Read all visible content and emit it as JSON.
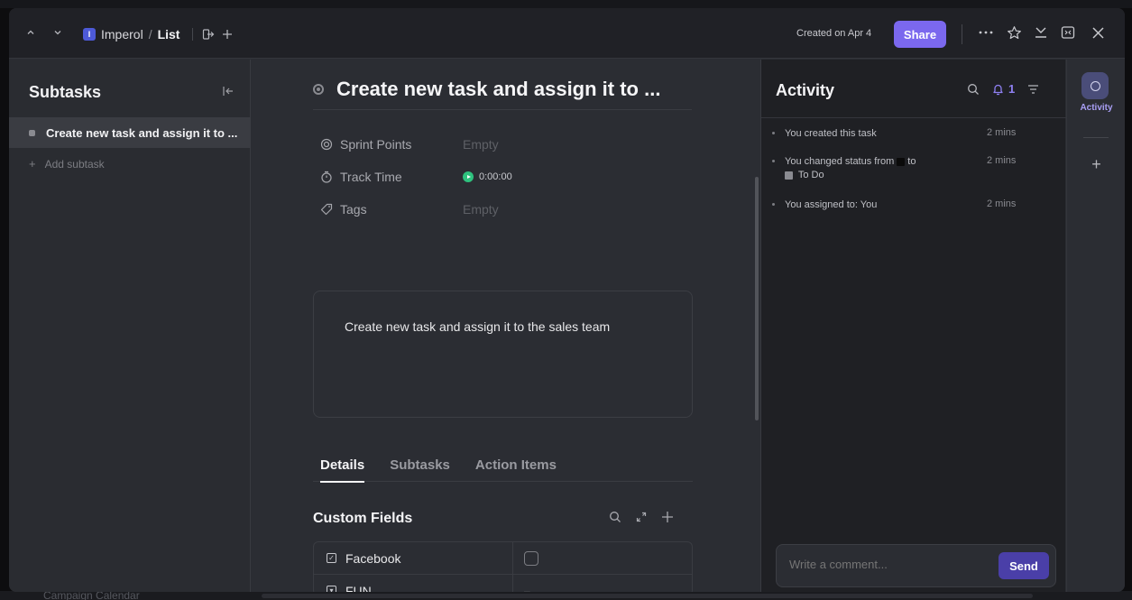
{
  "breadcrumb": {
    "space_initial": "I",
    "space_name": "Imperol",
    "separator": "/",
    "list_name": "List"
  },
  "header": {
    "created": "Created on Apr 4",
    "share_label": "Share"
  },
  "subtasks": {
    "title": "Subtasks",
    "items": [
      {
        "label": "Create new task and assign it to ..."
      }
    ],
    "add_label": "Add subtask"
  },
  "task": {
    "title": "Create new task and assign it to ...",
    "fields": [
      {
        "label": "Sprint Points",
        "value": "Empty"
      },
      {
        "label": "Track Time",
        "value": "0:00:00"
      },
      {
        "label": "Tags",
        "value": "Empty"
      }
    ],
    "description": "Create new task and assign it to the sales team"
  },
  "tabs": [
    {
      "label": "Details"
    },
    {
      "label": "Subtasks"
    },
    {
      "label": "Action Items"
    }
  ],
  "custom_fields": {
    "title": "Custom Fields",
    "rows": [
      {
        "name": "Facebook",
        "value": ""
      },
      {
        "name": "FUN",
        "value": "–"
      }
    ]
  },
  "activity": {
    "title": "Activity",
    "notification_count": "1",
    "items": [
      {
        "actor": "You",
        "text": "created this task",
        "time": "2 mins"
      },
      {
        "actor": "You",
        "text": "changed status from",
        "mid": "to",
        "status": "To Do",
        "time": "2 mins"
      },
      {
        "actor": "You",
        "text": "assigned to: You",
        "time": "2 mins"
      }
    ],
    "comment_placeholder": "Write a comment...",
    "send_label": "Send"
  },
  "rail": {
    "active_label": "Activity"
  },
  "backdrop": {
    "list_label": "Campaign Calendar"
  },
  "colors": {
    "accent": "#7b68ee",
    "space_badge": "#4d5ad8",
    "timer": "#2ec27e",
    "send": "#4a3fa8"
  }
}
